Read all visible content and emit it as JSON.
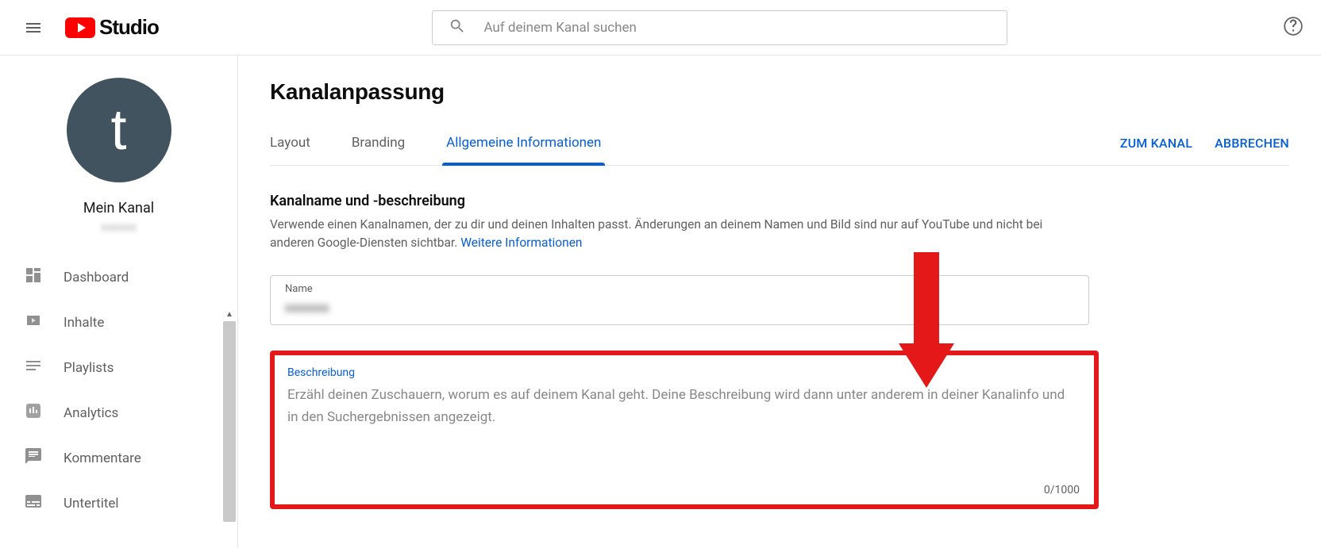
{
  "header": {
    "logo_text": "Studio",
    "search_placeholder": "Auf deinem Kanal suchen"
  },
  "channel": {
    "avatar_letter": "t",
    "name": "Mein Kanal",
    "sub": "xxxxxx"
  },
  "nav": {
    "dashboard": "Dashboard",
    "content": "Inhalte",
    "playlists": "Playlists",
    "analytics": "Analytics",
    "comments": "Kommentare",
    "subtitles": "Untertitel"
  },
  "main": {
    "title": "Kanalanpassung",
    "tabs": {
      "layout": "Layout",
      "branding": "Branding",
      "basic": "Allgemeine Informationen"
    },
    "actions": {
      "to_channel": "ZUM KANAL",
      "cancel": "ABBRECHEN"
    },
    "section": {
      "title": "Kanalname und -beschreibung",
      "desc": "Verwende einen Kanalnamen, der zu dir und deinen Inhalten passt. Änderungen an deinem Namen und Bild sind nur auf YouTube und nicht bei anderen Google-Diensten sichtbar. ",
      "more_info": "Weitere Informationen"
    },
    "name_field": {
      "label": "Name",
      "value": "xxxxxxx"
    },
    "desc_field": {
      "label": "Beschreibung",
      "placeholder": "Erzähl deinen Zuschauern, worum es auf deinem Kanal geht. Deine Beschreibung wird dann unter anderem in deiner Kanalinfo und in den Suchergebnissen angezeigt.",
      "count": "0/1000"
    }
  }
}
